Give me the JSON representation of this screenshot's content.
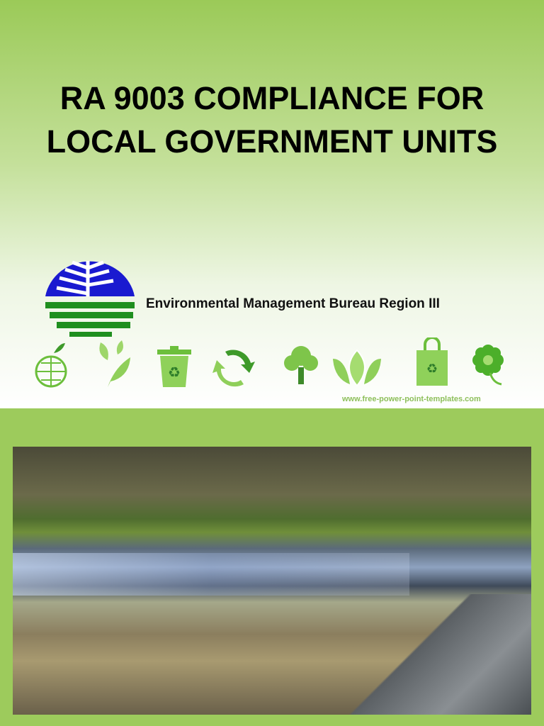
{
  "title": "RA 9003 COMPLIANCE FOR LOCAL GOVERNMENT UNITS",
  "organization": "Environmental Management Bureau Region III",
  "template_url": "www.free-power-point-templates.com",
  "icons": [
    "globe-apple-icon",
    "leaves-icon",
    "recycle-bin-icon",
    "recycle-arrows-icon",
    "tree-icon",
    "leaf-icon",
    "recycle-bag-icon",
    "flower-icon"
  ],
  "colors": {
    "background": "#9dcb5c",
    "icon_green": "#6cbf3c",
    "logo_blue": "#1a1ad0",
    "logo_green": "#1f8f1f"
  }
}
